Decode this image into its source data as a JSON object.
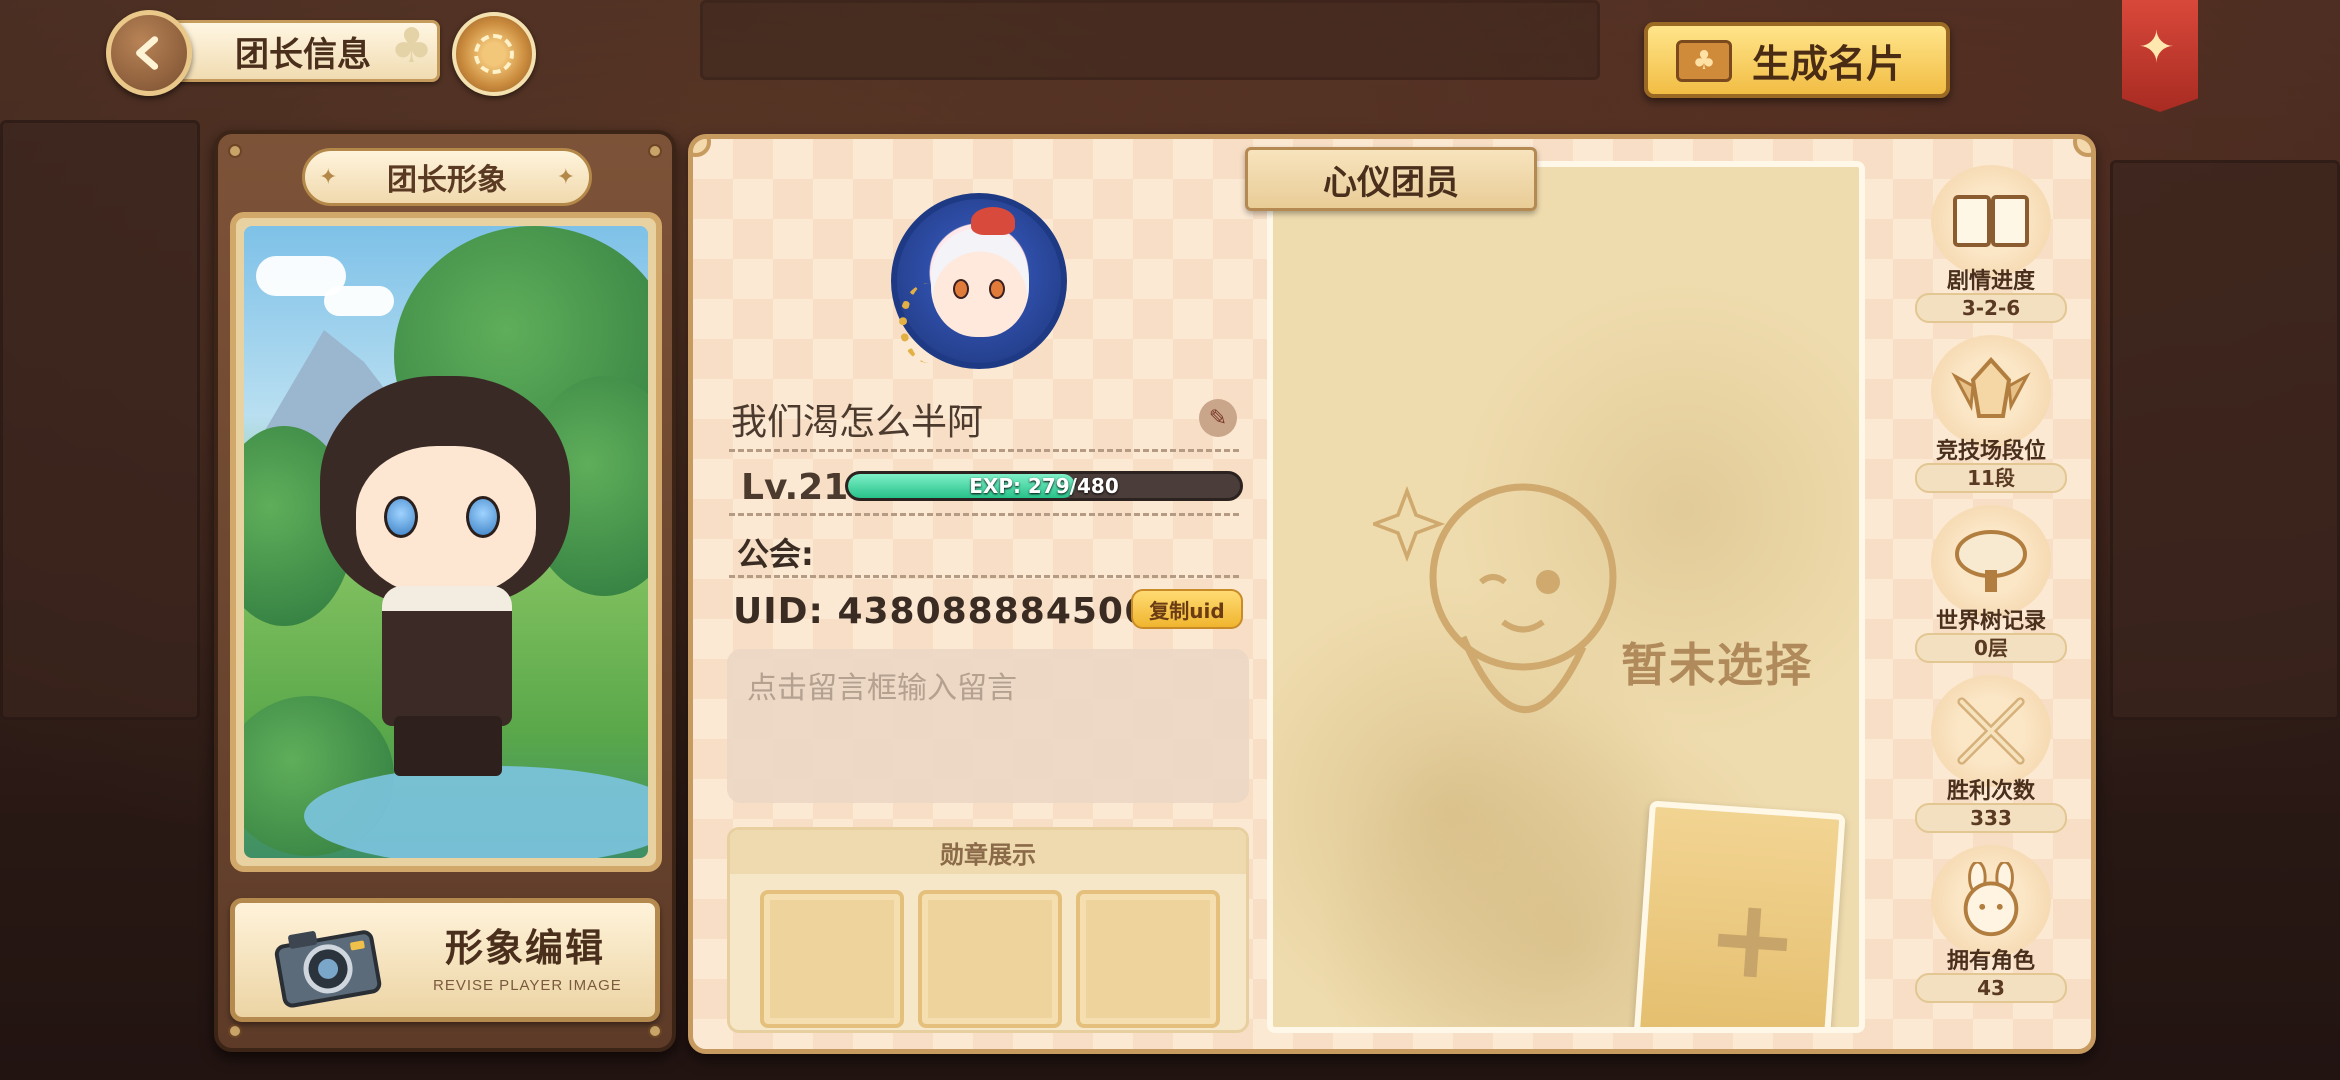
{
  "header": {
    "title": "团长信息",
    "generate_card_label": "生成名片"
  },
  "avatar_section": {
    "title": "团长形象",
    "edit_label": "形象编辑",
    "edit_sublabel": "REVISE PLAYER IMAGE"
  },
  "profile": {
    "name": "我们渴怎么半阿",
    "level_label": "Lv.21",
    "exp_text": "EXP: 279/480",
    "exp_fraction": 0.58,
    "guild_label": "公会:",
    "uid_label": "UID: 438088884506",
    "copy_uid_label": "复制uid",
    "message_placeholder": "点击留言框输入留言"
  },
  "medals": {
    "title": "勋章展示",
    "slots": 3
  },
  "partner": {
    "title": "心仪团员",
    "status": "暂未选择",
    "add_symbol": "+"
  },
  "stats": [
    {
      "label": "剧情进度",
      "value": "3-2-6",
      "icon": "book-icon"
    },
    {
      "label": "竞技场段位",
      "value": "11段",
      "icon": "arena-rank-icon"
    },
    {
      "label": "世界树记录",
      "value": "0层",
      "icon": "world-tree-icon"
    },
    {
      "label": "胜利次数",
      "value": "333",
      "icon": "crossed-swords-icon"
    },
    {
      "label": "拥有角色",
      "value": "43",
      "icon": "bunny-character-icon"
    }
  ],
  "colors": {
    "accent_gold": "#f2bd44",
    "panel_bg": "#fbe9d4",
    "exp_green": "#27c28a",
    "frame_brown": "#7d5338"
  }
}
